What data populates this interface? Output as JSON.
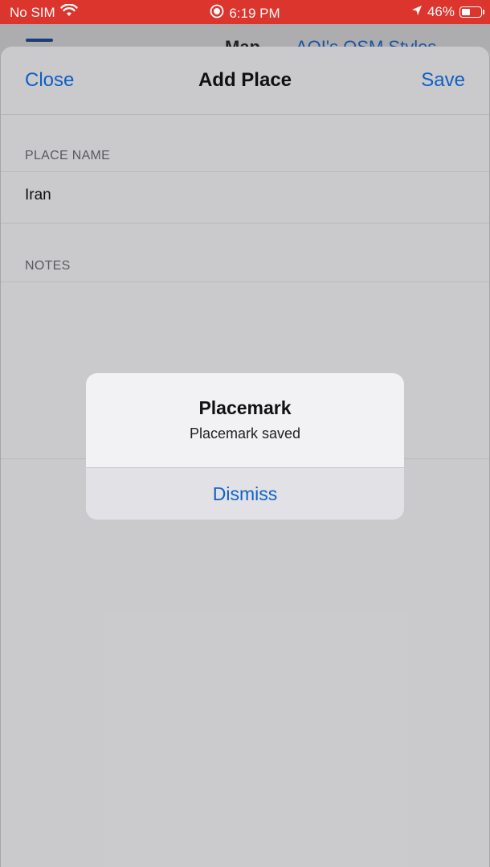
{
  "status_bar": {
    "carrier": "No SIM",
    "time": "6:19 PM",
    "battery": "46%",
    "battery_level": 0.46
  },
  "background_app": {
    "tab_map": "Map",
    "tab_styles": "AQI's  OSM Styles"
  },
  "sheet": {
    "close_label": "Close",
    "title": "Add Place",
    "save_label": "Save",
    "place_name_header": "PLACE NAME",
    "place_name_value": "Iran",
    "notes_header": "NOTES",
    "notes_value": ""
  },
  "alert": {
    "title": "Placemark",
    "message": "Placemark saved",
    "dismiss_label": "Dismiss"
  },
  "colors": {
    "status_bar": "#e0372f",
    "accent": "#0f62c7"
  },
  "icons": [
    "wifi-icon",
    "record-icon",
    "location-arrow-icon",
    "battery-icon",
    "menu-icon"
  ]
}
